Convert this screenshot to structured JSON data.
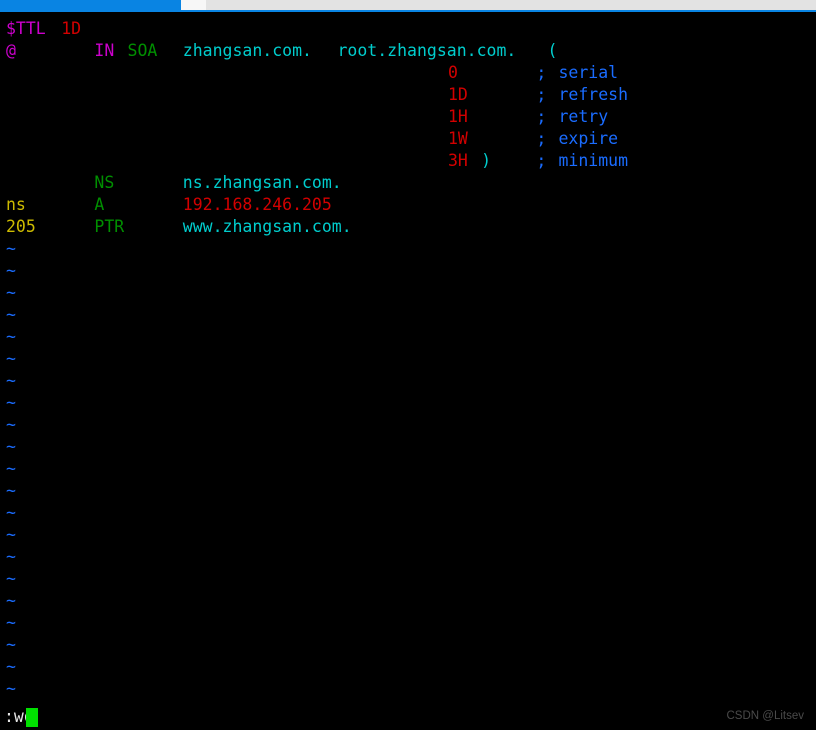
{
  "window": {
    "topbar": {
      "blue_segment_color": "#0984e3",
      "white_segment_color": "#f7f7f7",
      "grey_segment_color": "#e3e3e3"
    }
  },
  "terminal": {
    "background_color": "#000000",
    "palette": {
      "magenta": "#cd00cd",
      "red": "#d20000",
      "green": "#008f00",
      "cyan": "#00cdcd",
      "blue": "#1a6cff",
      "yellow": "#cdbb00",
      "white": "#e6e6e6",
      "cursor": "#00e000"
    },
    "lines": [
      {
        "index": 0,
        "tokens": [
          {
            "col": 0,
            "text": "$TTL",
            "color": "magenta"
          },
          {
            "col": 5,
            "text": "1D",
            "color": "red"
          }
        ]
      },
      {
        "index": 1,
        "tokens": [
          {
            "col": 0,
            "text": "@",
            "color": "magenta"
          },
          {
            "col": 8,
            "text": "IN",
            "color": "magenta"
          },
          {
            "col": 11,
            "text": "SOA",
            "color": "green"
          },
          {
            "col": 16,
            "text": "zhangsan.com.",
            "color": "cyan"
          },
          {
            "col": 30,
            "text": "root.zhangsan.com.",
            "color": "cyan"
          },
          {
            "col": 49,
            "text": "(",
            "color": "cyan"
          }
        ]
      },
      {
        "index": 2,
        "tokens": [
          {
            "col": 40,
            "text": "0",
            "color": "red"
          },
          {
            "col": 48,
            "text": ";",
            "color": "blue"
          },
          {
            "col": 50,
            "text": "serial",
            "color": "blue"
          }
        ]
      },
      {
        "index": 3,
        "tokens": [
          {
            "col": 40,
            "text": "1D",
            "color": "red"
          },
          {
            "col": 48,
            "text": ";",
            "color": "blue"
          },
          {
            "col": 50,
            "text": "refresh",
            "color": "blue"
          }
        ]
      },
      {
        "index": 4,
        "tokens": [
          {
            "col": 40,
            "text": "1H",
            "color": "red"
          },
          {
            "col": 48,
            "text": ";",
            "color": "blue"
          },
          {
            "col": 50,
            "text": "retry",
            "color": "blue"
          }
        ]
      },
      {
        "index": 5,
        "tokens": [
          {
            "col": 40,
            "text": "1W",
            "color": "red"
          },
          {
            "col": 48,
            "text": ";",
            "color": "blue"
          },
          {
            "col": 50,
            "text": "expire",
            "color": "blue"
          }
        ]
      },
      {
        "index": 6,
        "tokens": [
          {
            "col": 40,
            "text": "3H",
            "color": "red"
          },
          {
            "col": 43,
            "text": ")",
            "color": "cyan"
          },
          {
            "col": 48,
            "text": ";",
            "color": "blue"
          },
          {
            "col": 50,
            "text": "minimum",
            "color": "blue"
          }
        ]
      },
      {
        "index": 7,
        "tokens": [
          {
            "col": 8,
            "text": "NS",
            "color": "green"
          },
          {
            "col": 16,
            "text": "ns.zhangsan.com.",
            "color": "cyan"
          }
        ]
      },
      {
        "index": 8,
        "tokens": [
          {
            "col": 0,
            "text": "ns",
            "color": "yellow"
          },
          {
            "col": 8,
            "text": "A",
            "color": "green"
          },
          {
            "col": 16,
            "text": "192.168.246.205",
            "color": "red"
          }
        ]
      },
      {
        "index": 9,
        "tokens": [
          {
            "col": 0,
            "text": "205",
            "color": "yellow"
          },
          {
            "col": 8,
            "text": "PTR",
            "color": "green"
          },
          {
            "col": 16,
            "text": "www.zhangsan.com.",
            "color": "cyan"
          }
        ]
      }
    ],
    "empty_line_marker": "~",
    "empty_line_count": 21
  },
  "statusline": {
    "command": ":wq",
    "cursor_visible": true
  },
  "watermark": {
    "text": "CSDN @Litsev"
  }
}
